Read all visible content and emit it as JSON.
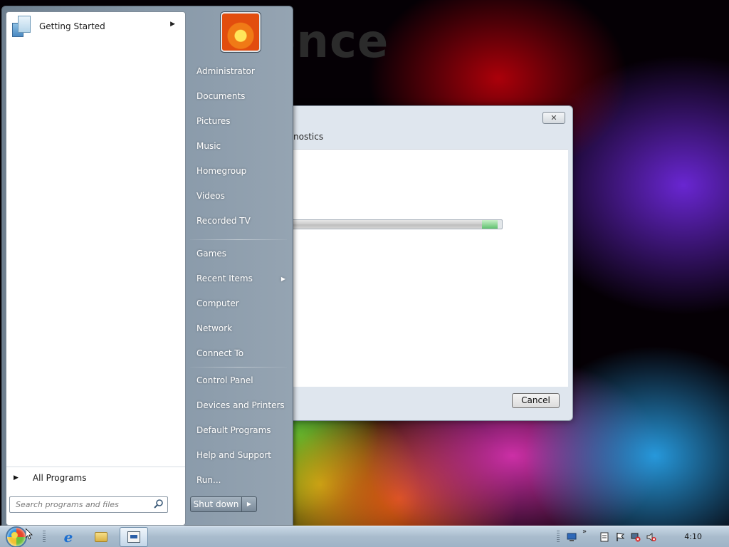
{
  "wallpaper": {
    "partial_text": "ence"
  },
  "dialog": {
    "title_partial": "nostics",
    "close_label": "✕",
    "cancel_label": "Cancel",
    "progress_fraction": 0.98
  },
  "start_menu": {
    "pinned": [
      {
        "label": "Getting Started",
        "has_submenu": true,
        "icon": "getting-started-icon"
      }
    ],
    "all_programs_label": "All Programs",
    "search": {
      "placeholder": "Search programs and files",
      "value": ""
    },
    "right_items": [
      {
        "label": "Administrator"
      },
      {
        "label": "Documents"
      },
      {
        "label": "Pictures"
      },
      {
        "label": "Music"
      },
      {
        "label": "Homegroup"
      },
      {
        "label": "Videos"
      },
      {
        "label": "Recorded TV"
      },
      {
        "label": "Games"
      },
      {
        "label": "Recent Items",
        "has_submenu": true
      },
      {
        "label": "Computer"
      },
      {
        "label": "Network"
      },
      {
        "label": "Connect To"
      },
      {
        "label": "Control Panel"
      },
      {
        "label": "Devices and Printers"
      },
      {
        "label": "Default Programs"
      },
      {
        "label": "Help and Support"
      },
      {
        "label": "Run..."
      }
    ],
    "shutdown_label": "Shut down"
  },
  "taskbar": {
    "pinned_apps": [
      "internet-explorer-icon",
      "windows-explorer-icon",
      "running-app-icon"
    ],
    "tray_overflow": "»",
    "clock": "4:10"
  },
  "colors": {
    "menu_right_pane": "#8798a8",
    "taskbar": "#a9bccd",
    "progress_end": "#5fc16f"
  }
}
